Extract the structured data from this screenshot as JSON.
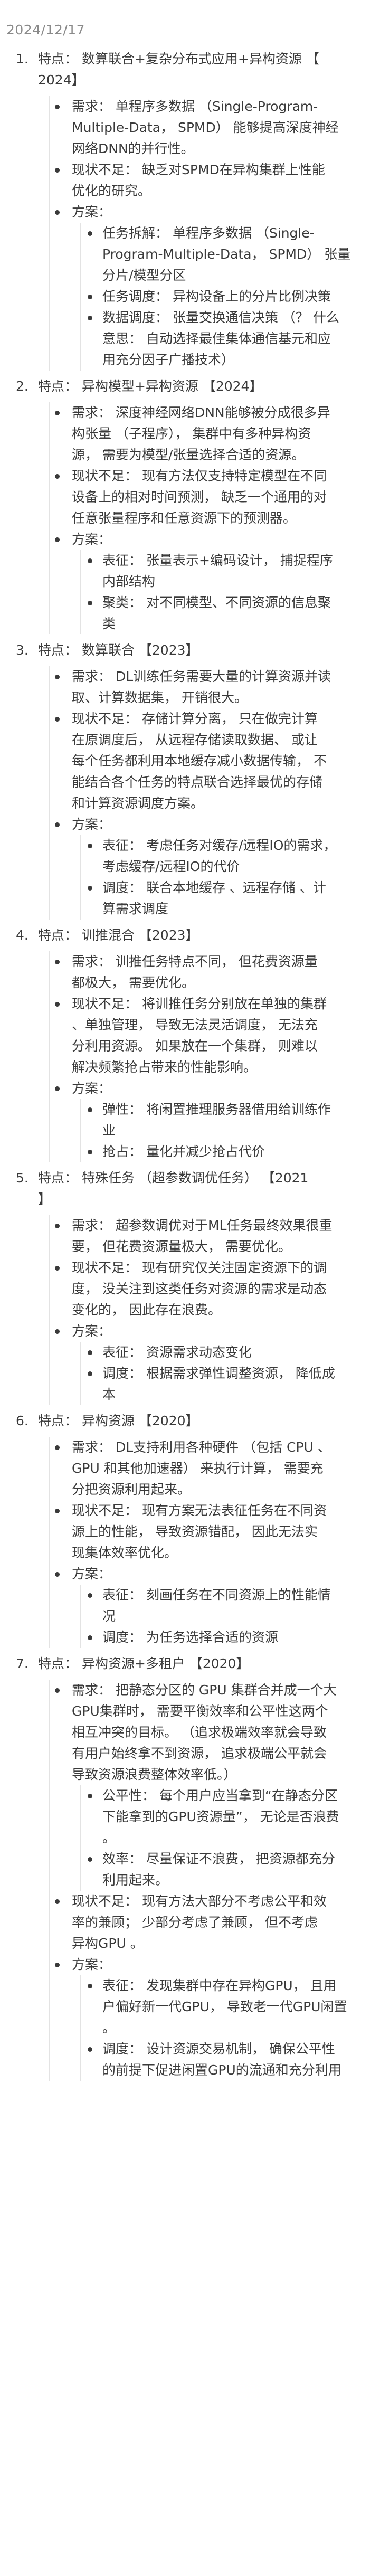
{
  "date": "2024/12/17",
  "items": [
    {
      "num": "1.",
      "title": "特点：  数算联合+复杂分布式应用+异构资源 【\n2024】",
      "entries": [
        {
          "text": "需求：  单程序多数据 （Single-Program-\nMultiple-Data， SPMD） 能够提高深度神经\n网络DNN的并行性。"
        },
        {
          "text": "现状不足：  缺乏对SPMD在异构集群上性能\n优化的研究。"
        },
        {
          "text": "方案：",
          "children": [
            "任务拆解：  单程序多数据 （Single-\nProgram-Multiple-Data， SPMD） 张量\n分片/模型分区",
            "任务调度：  异构设备上的分片比例决策",
            "数据调度：  张量交换通信决策 （？ 什么\n意思： 自动选择最佳集体通信基元和应\n用充分因子广播技术）"
          ]
        }
      ]
    },
    {
      "num": "2.",
      "title": "特点：  异构模型+异构资源 【2024】",
      "entries": [
        {
          "text": "需求：  深度神经网络DNN能够被分成很多异\n构张量 （子程序）， 集群中有多种异构资\n源， 需要为模型/张量选择合适的资源。"
        },
        {
          "text": "现状不足：  现有方法仅支持特定模型在不同\n设备上的相对时间预测， 缺乏一个通用的对\n任意张量程序和任意资源下的预测器。"
        },
        {
          "text": "方案：",
          "children": [
            "表征：  张量表示+编码设计， 捕捉程序\n内部结构",
            "聚类：  对不同模型、不同资源的信息聚\n类"
          ]
        }
      ]
    },
    {
      "num": "3.",
      "title": "特点：  数算联合 【2023】",
      "entries": [
        {
          "text": "需求：  DL训练任务需要大量的计算资源并读\n取、计算数据集， 开销很大。"
        },
        {
          "text": "现状不足：  存储计算分离， 只在做完计算\n在原调度后， 从远程存储读取数据、 或让\n每个任务都利用本地缓存减小数据传输， 不\n能结合各个任务的特点联合选择最优的存储\n和计算资源调度方案。"
        },
        {
          "text": "方案：",
          "children": [
            "表征：  考虑任务对缓存/远程IO的需求，\n考虑缓存/远程IO的代价",
            "调度：  联合本地缓存 、远程存储 、计\n算需求调度"
          ]
        }
      ]
    },
    {
      "num": "4.",
      "title": "特点：  训推混合 【2023】",
      "entries": [
        {
          "text": "需求：  训推任务特点不同， 但花费资源量\n都极大， 需要优化。"
        },
        {
          "text": "现状不足：  将训推任务分别放在单独的集群\n、单独管理， 导致无法灵活调度， 无法充\n分利用资源。 如果放在一个集群， 则难以\n解决频繁抢占带来的性能影响。"
        },
        {
          "text": "方案：",
          "children": [
            "弹性：  将闲置推理服务器借用给训练作\n业",
            "抢占：  量化并减少抢占代价"
          ]
        }
      ]
    },
    {
      "num": "5.",
      "title": "特点：  特殊任务 （超参数调优任务） 【2021\n】",
      "entries": [
        {
          "text": "需求：  超参数调优对于ML任务最终效果很重\n要， 但花费资源量极大， 需要优化。"
        },
        {
          "text": "现状不足：  现有研究仅关注固定资源下的调\n度， 没关注到这类任务对资源的需求是动态\n变化的， 因此存在浪费。"
        },
        {
          "text": "方案：",
          "children": [
            "表征：  资源需求动态变化",
            "调度：  根据需求弹性调整资源， 降低成\n本"
          ]
        }
      ]
    },
    {
      "num": "6.",
      "title": "特点：  异构资源 【2020】",
      "entries": [
        {
          "text": "需求：  DL支持利用各种硬件 （包括 CPU 、\nGPU 和其他加速器） 来执行计算， 需要充\n分把资源利用起来。"
        },
        {
          "text": "现状不足：  现有方案无法表征任务在不同资\n源上的性能， 导致资源错配， 因此无法实\n现集体效率优化。"
        },
        {
          "text": "方案：",
          "children": [
            "表征：  刻画任务在不同资源上的性能情\n况",
            "调度：  为任务选择合适的资源"
          ]
        }
      ]
    },
    {
      "num": "7.",
      "title": "特点：  异构资源+多租户 【2020】",
      "entries": [
        {
          "text": "需求：  把静态分区的 GPU 集群合并成一个大\nGPU集群时， 需要平衡效率和公平性这两个\n相互冲突的目标。 （追求极端效率就会导致\n有用户始终拿不到资源， 追求极端公平就会\n导致资源浪费整体效率低。）",
          "children": [
            "公平性：  每个用户应当拿到“在静态分区\n下能拿到的GPU资源量”， 无论是否浪费\n。",
            "效率：  尽量保证不浪费， 把资源都充分\n利用起来。"
          ]
        },
        {
          "text": "现状不足：  现有方法大部分不考虑公平和效\n率的兼顾； 少部分考虑了兼顾， 但不考虑\n异构GPU 。"
        },
        {
          "text": "方案：",
          "children": [
            "表征：  发现集群中存在异构GPU， 且用\n户偏好新一代GPU， 导致老一代GPU闲置\n。",
            "调度：  设计资源交易机制， 确保公平性\n的前提下促进闲置GPU的流通和充分利用"
          ]
        }
      ]
    }
  ]
}
